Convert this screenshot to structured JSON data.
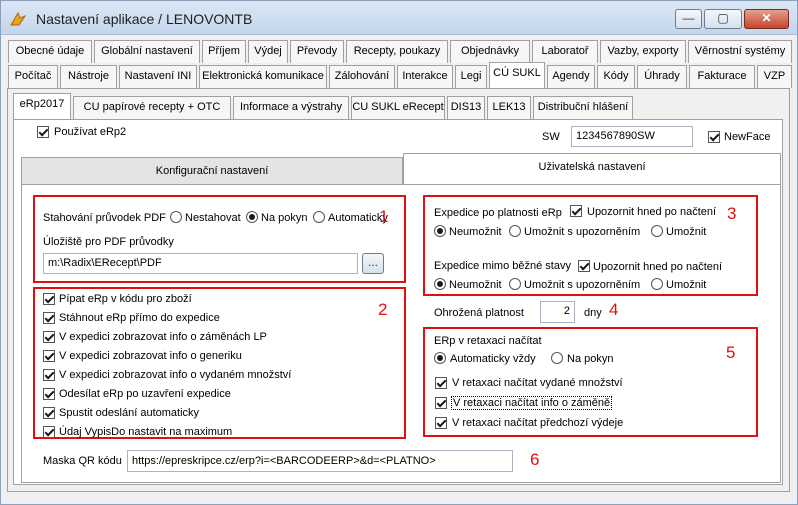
{
  "window": {
    "title": "Nastavení aplikace / LENOVONTB",
    "minimize": "—",
    "maximize": "▢",
    "close": "✕"
  },
  "tabs_row1": [
    "Obecné údaje",
    "Globální nastavení",
    "Příjem",
    "Výdej",
    "Převody",
    "Recepty, poukazy",
    "Objednávky",
    "Laboratoř",
    "Vazby, exporty",
    "Věrnostní systémy"
  ],
  "tabs_row2": [
    "Počítač",
    "Nástroje",
    "Nastavení INI",
    "Elektronická komunikace",
    "Zálohování",
    "Interakce",
    "Legi",
    "CÚ SUKL",
    "Agendy",
    "Kódy",
    "Úhrady",
    "Fakturace",
    "VZP"
  ],
  "tabs_row3": [
    "eRp2017",
    "CU papírové recepty + OTC",
    "Informace a výstrahy",
    "CU SUKL eRecept",
    "DIS13",
    "LEK13",
    "Distribuční hlášení"
  ],
  "top": {
    "pouzivat_label": "Používat eRp2",
    "sw_label": "SW",
    "sw_value": "1234567890SW",
    "newface_label": "NewFace"
  },
  "subtabs": [
    "Konfigurační nastavení",
    "Uživatelská nastavení"
  ],
  "box1": {
    "download_label": "Stahování průvodek PDF",
    "options": [
      "Nestahovat",
      "Na pokyn",
      "Automaticky"
    ],
    "storage_label": "Úložiště pro PDF průvodky",
    "path": "m:\\Radix\\ERecept\\PDF",
    "browse": "..."
  },
  "box2": {
    "items": [
      "Pípat eRp v kódu pro zboží",
      "Stáhnout eRp přímo do expedice",
      "V expedici zobrazovat info o záměnách LP",
      "V expedici zobrazovat info o generiku",
      "V expedici zobrazovat info o vydaném množství",
      "Odesílat eRp po uzavření expedice",
      "Spustit odeslání automaticky",
      "Údaj VypisDo nastavit na maximum"
    ]
  },
  "box3": {
    "exp1_label": "Expedice po platnosti eRp",
    "warn_label": "Upozornit hned po načtení",
    "opts": [
      "Neumožnit",
      "Umožnit s upozorněním",
      "Umožnit"
    ],
    "exp2_label": "Expedice mimo běžné stavy"
  },
  "box4": {
    "label": "Ohrožená platnost",
    "value": "2",
    "unit": "dny"
  },
  "box5": {
    "title": "ERp v retaxaci načítat",
    "opts": [
      "Automaticky vždy",
      "Na pokyn"
    ],
    "items": [
      "V retaxaci načítat vydané množství",
      "V retaxaci načítat info o záměně",
      "V retaxaci načítat předchozí výdeje"
    ]
  },
  "qr": {
    "label": "Maska QR kódu",
    "value": "https://epreskripce.cz/erp?i=<BARCODEERP>&d=<PLATNO>"
  },
  "markers": [
    "1",
    "2",
    "3",
    "4",
    "5",
    "6"
  ],
  "colors": {
    "annotation": "#e01010"
  }
}
